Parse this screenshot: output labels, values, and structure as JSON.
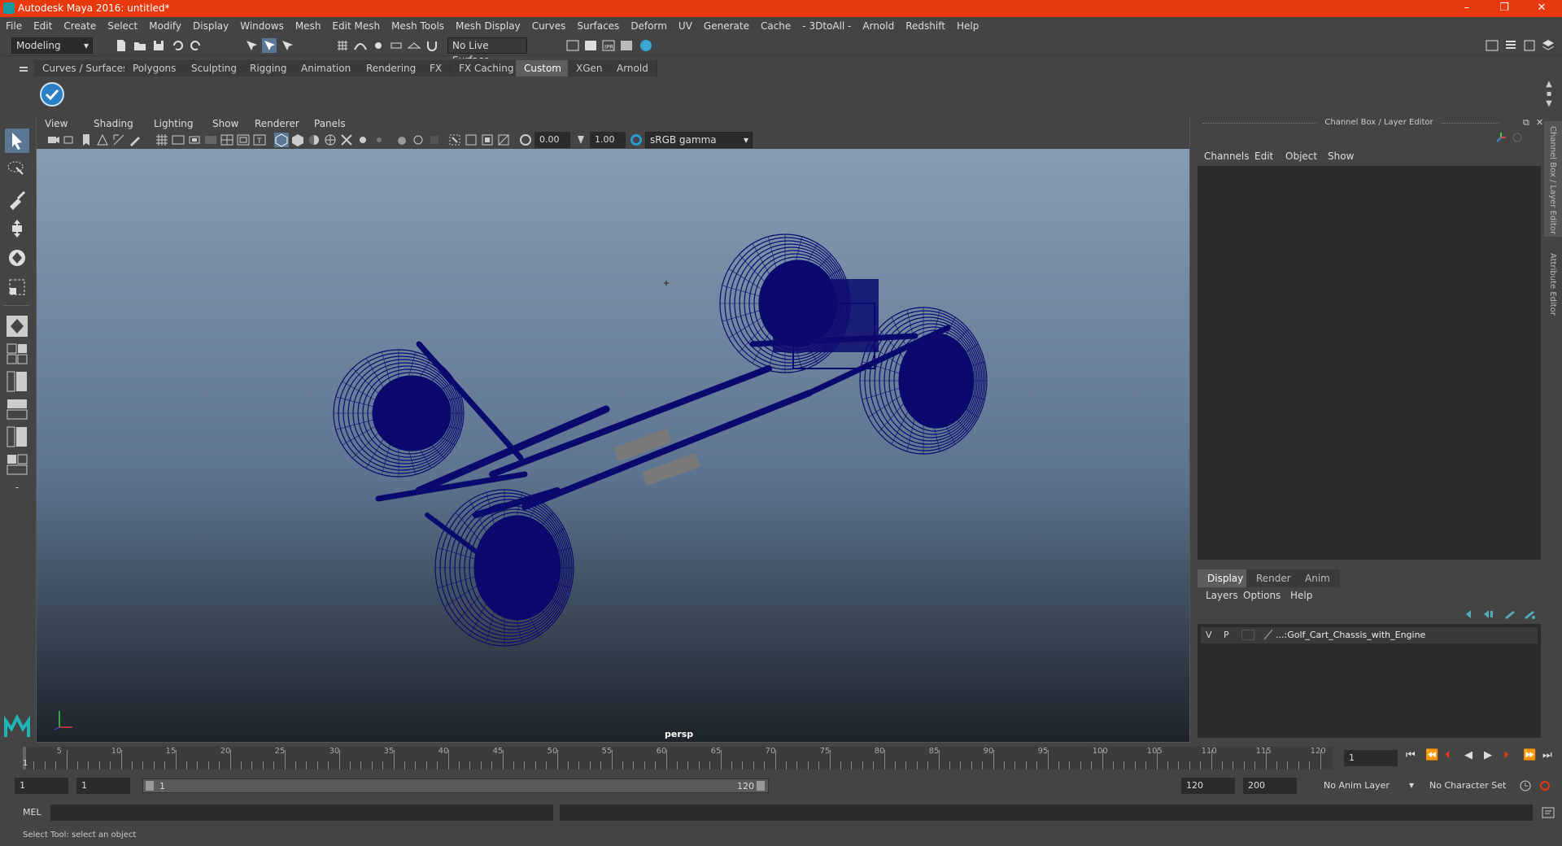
{
  "window": {
    "title": "Autodesk Maya 2016: untitled*",
    "minimize": "–",
    "restore": "❐",
    "close": "✕"
  },
  "menus": [
    "File",
    "Edit",
    "Create",
    "Select",
    "Modify",
    "Display",
    "Windows",
    "Mesh",
    "Edit Mesh",
    "Mesh Tools",
    "Mesh Display",
    "Curves",
    "Surfaces",
    "Deform",
    "UV",
    "Generate",
    "Cache",
    "- 3DtoAll -",
    "Arnold",
    "Redshift",
    "Help"
  ],
  "toolbar": {
    "mode": "Modeling",
    "live_surface": "No Live Surface"
  },
  "shelf_tabs": [
    "Curves / Surfaces",
    "Polygons",
    "Sculpting",
    "Rigging",
    "Animation",
    "Rendering",
    "FX",
    "FX Caching",
    "Custom",
    "XGen",
    "Arnold"
  ],
  "active_shelf": "Custom",
  "viewport": {
    "menus": [
      "View",
      "Shading",
      "Lighting",
      "Show",
      "Renderer",
      "Panels"
    ],
    "exposure": "0.00",
    "gamma": "1.00",
    "color_space": "sRGB gamma",
    "camera_label": "persp",
    "wire_color": "#0a0a6e"
  },
  "channel_box": {
    "title": "Channel Box / Layer Editor",
    "menus": [
      "Channels",
      "Edit",
      "Object",
      "Show"
    ]
  },
  "layer_editor": {
    "tabs": [
      "Display",
      "Render",
      "Anim"
    ],
    "active_tab": "Display",
    "menus": [
      "Layers",
      "Options",
      "Help"
    ],
    "layers": [
      {
        "v": "V",
        "p": "P",
        "name": "...:Golf_Cart_Chassis_with_Engine"
      }
    ]
  },
  "side_tabs": {
    "channel": "Channel Box / Layer Editor",
    "attr": "Attribute Editor"
  },
  "timeline": {
    "ticks": [
      "5",
      "10",
      "15",
      "20",
      "25",
      "30",
      "35",
      "40",
      "45",
      "50",
      "55",
      "60",
      "65",
      "70",
      "75",
      "80",
      "85",
      "90",
      "95",
      "100",
      "105",
      "110",
      "115",
      "120"
    ],
    "current_marker": "1",
    "current_frame": "1"
  },
  "range": {
    "start": "1",
    "start_inner": "1",
    "slider_start": "1",
    "slider_end": "120",
    "end_inner": "120",
    "end": "200",
    "anim_layer": "No Anim Layer",
    "char_set": "No Character Set"
  },
  "command_line": {
    "label": "MEL"
  },
  "status": {
    "message": "Select Tool: select an object"
  }
}
